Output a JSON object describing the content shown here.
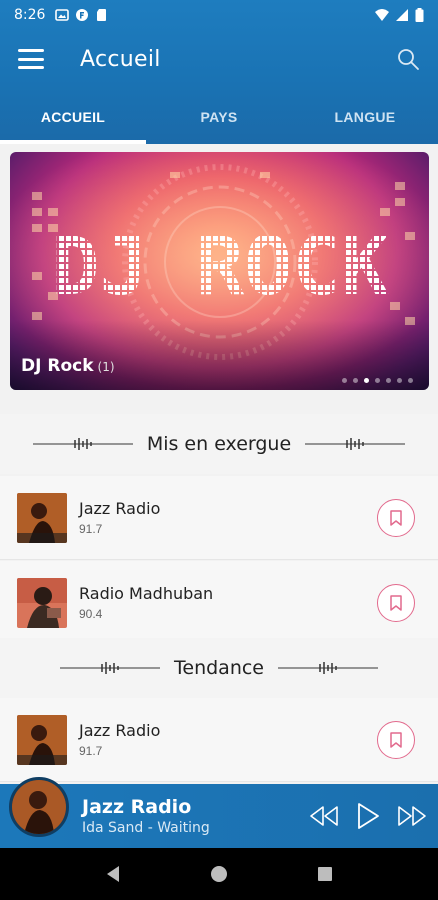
{
  "status_bar": {
    "time": "8:26"
  },
  "toolbar": {
    "title": "Accueil",
    "menu_icon": "hamburger-icon",
    "search_icon": "search-icon"
  },
  "tabs": [
    {
      "label": "ACCUEIL",
      "active": true
    },
    {
      "label": "PAYS",
      "active": false
    },
    {
      "label": "LANGUE",
      "active": false
    }
  ],
  "banner": {
    "artwork_text": "DJ ROCK",
    "caption": "DJ Rock",
    "count": "(1)",
    "dots_total": 7,
    "dots_active_index": 2
  },
  "featured": {
    "title": "Mis en exergue",
    "items": [
      {
        "name": "Jazz Radio",
        "freq": "91.7"
      },
      {
        "name": "Radio Madhuban",
        "freq": "90.4"
      }
    ]
  },
  "trending": {
    "title": "Tendance",
    "items": [
      {
        "name": "Jazz Radio",
        "freq": "91.7"
      }
    ]
  },
  "player": {
    "station": "Jazz Radio",
    "status": "Ida Sand - Waiting"
  },
  "colors": {
    "primary": "#1b74b6",
    "accent_bookmark": "#e26a8d",
    "background": "#f2f2f2"
  }
}
